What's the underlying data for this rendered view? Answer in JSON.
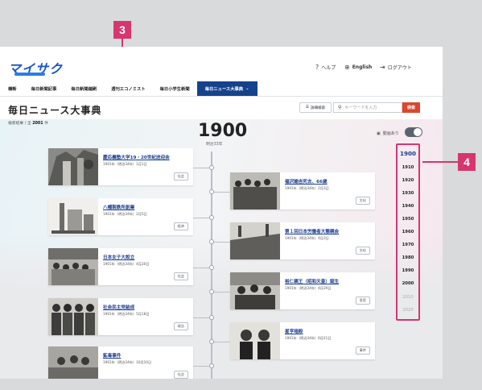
{
  "header": {
    "logo_text": "マイサク",
    "help_label": "ヘルプ",
    "english_label": "English",
    "logout_label": "ログアウト"
  },
  "nav": {
    "items": [
      {
        "label": "横断",
        "active": false
      },
      {
        "label": "毎日新聞記事",
        "active": false
      },
      {
        "label": "毎日新聞縮刷",
        "active": false
      },
      {
        "label": "週刊エコノミスト",
        "active": false
      },
      {
        "label": "毎日小学生新聞",
        "active": false
      },
      {
        "label": "毎日ニュース大事典",
        "active": true
      }
    ],
    "chevron_icon": "chevron-down-icon"
  },
  "page": {
    "title": "毎日ニュース大事典",
    "count_prefix": "検索結果 / 全",
    "count_value": "2001",
    "count_suffix": "件",
    "advanced_search_label": "詳細検索",
    "search_placeholder": "キーワードを入力",
    "search_button_label": "検索",
    "video_only_label": "動画あり",
    "video_toggle_on": false
  },
  "timeline": {
    "year": "1900",
    "era": "明治33年",
    "events_left": [
      {
        "title": "慶応義塾大学19・20世紀送迎会",
        "date": "1901年（明治34年）1月1日",
        "tag": "社会"
      },
      {
        "title": "八幡製鉄所創業",
        "date": "1901年（明治34年）2月5日",
        "tag": "経済"
      },
      {
        "title": "日本女子大設立",
        "date": "1901年（明治34年）4月20日",
        "tag": "社会"
      },
      {
        "title": "社会民主党結成",
        "date": "1901年（明治34年）5月18日",
        "tag": "政治"
      },
      {
        "title": "鉱毒事件",
        "date": "1901年（明治34年）10月10日",
        "tag": "社会"
      }
    ],
    "events_right": [
      {
        "title": "福沢諭吉死去、66歳",
        "date": "1901年（明治34年）2月3日",
        "tag": "文化"
      },
      {
        "title": "第１回日本労働者大懇親会",
        "date": "1901年（明治34年）4月3日",
        "tag": "文化"
      },
      {
        "title": "裕仁親王（昭和天皇）誕生",
        "date": "1901年（明治34年）4月29日",
        "tag": "皇室"
      },
      {
        "title": "星亨暗殺",
        "date": "1901年（明治34年）6月21日",
        "tag": "事件"
      }
    ]
  },
  "decades": [
    {
      "label": "1900",
      "state": "active"
    },
    {
      "label": "1910",
      "state": "normal"
    },
    {
      "label": "1920",
      "state": "normal"
    },
    {
      "label": "1930",
      "state": "normal"
    },
    {
      "label": "1940",
      "state": "normal"
    },
    {
      "label": "1950",
      "state": "normal"
    },
    {
      "label": "1960",
      "state": "normal"
    },
    {
      "label": "1970",
      "state": "normal"
    },
    {
      "label": "1980",
      "state": "normal"
    },
    {
      "label": "1990",
      "state": "normal"
    },
    {
      "label": "2000",
      "state": "normal"
    },
    {
      "label": "2010",
      "state": "dim"
    },
    {
      "label": "2020",
      "state": "dim"
    }
  ],
  "callouts": {
    "left": "3",
    "right": "4"
  },
  "colors": {
    "brand_blue": "#16428c",
    "link_blue": "#1a3d8f",
    "search_red": "#d9472f",
    "callout_pink": "#d6356e"
  }
}
